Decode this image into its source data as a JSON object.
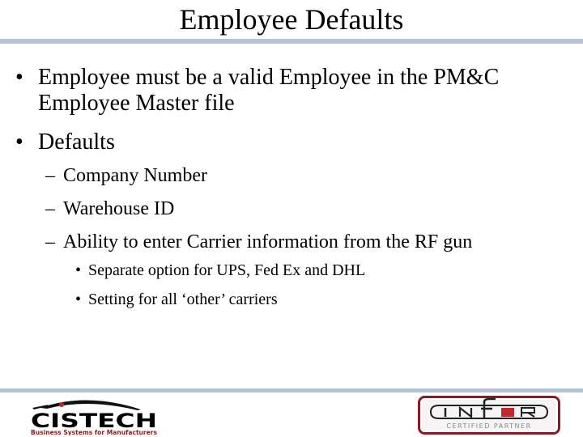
{
  "slide": {
    "title": "Employee Defaults",
    "bullets": [
      {
        "marker": "•",
        "lines": [
          "Employee must be a valid Employee in the PM&C",
          "Employee Master file"
        ]
      },
      {
        "marker": "•",
        "text": "Defaults",
        "subitems": [
          {
            "marker": "–",
            "text": "Company Number"
          },
          {
            "marker": "–",
            "text": "Warehouse ID"
          },
          {
            "marker": "–",
            "text": "Ability to enter Carrier information from the RF gun",
            "subitems": [
              {
                "marker": "•",
                "text": "Separate option for UPS, Fed Ex and DHL"
              },
              {
                "marker": "•",
                "text": "Setting for all ‘other’ carriers"
              }
            ]
          }
        ]
      }
    ]
  },
  "footer": {
    "left_logo": {
      "name": "CISTECH",
      "tagline": "Business Systems for Manufacturers",
      "text_color": "#000000",
      "tagline_color": "#8b1a1a",
      "accent_color": "#c0282d"
    },
    "right_logo": {
      "name": "infor",
      "caption": "CERTIFIED PARTNER",
      "border_color": "#8b1a24",
      "accent_color": "#c0282d"
    }
  },
  "colors": {
    "rule": "#b4c4d6",
    "text": "#000000",
    "background": "#ffffff"
  }
}
